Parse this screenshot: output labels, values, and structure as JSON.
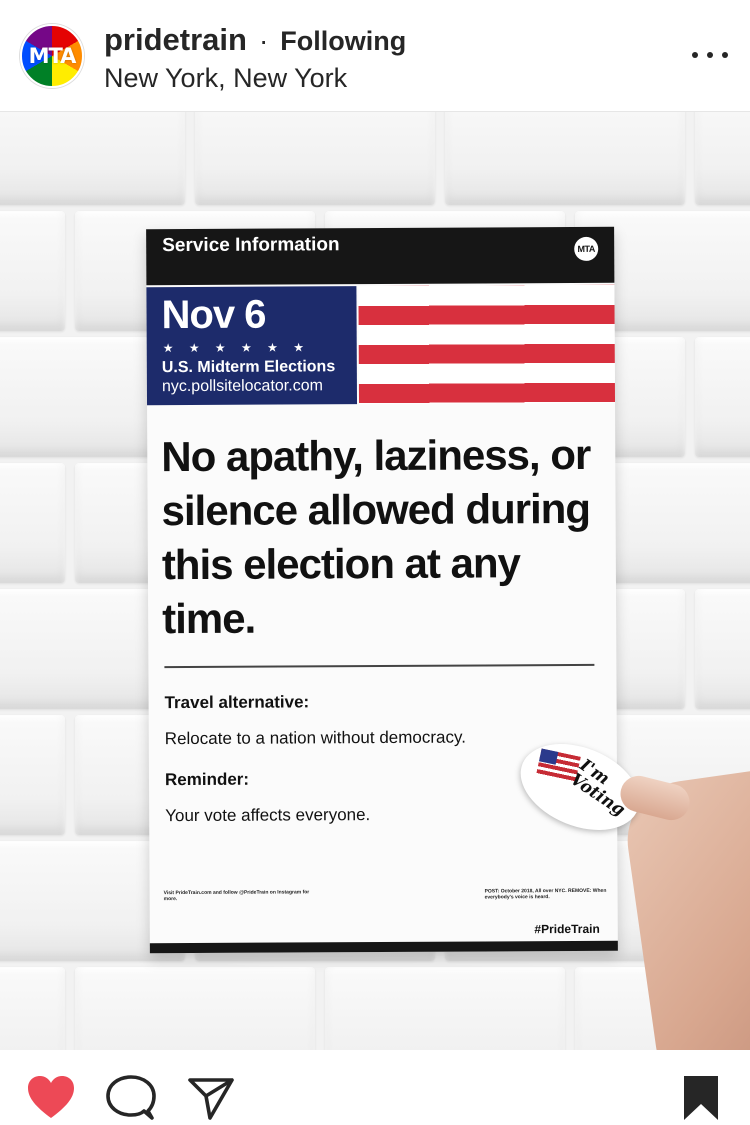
{
  "post": {
    "avatar_text": "MTA",
    "username": "pridetrain",
    "separator": "·",
    "follow_state": "Following",
    "location": "New York, New York"
  },
  "photo": {
    "service_info": "Service Information",
    "logo_text": "MTA",
    "date": "Nov 6",
    "stars": "★ ★ ★ ★ ★ ★",
    "election": "U.S. Midterm Elections",
    "url": "nyc.pollsitelocator.com",
    "headline": "No apathy, laziness, or silence allowed during this election at any time.",
    "label_1": "Travel alternative:",
    "text_1": "Relocate to a nation without democracy.",
    "label_2": "Reminder:",
    "text_2": "Your vote affects everyone.",
    "fine_print_left": "Visit PrideTrain.com and follow @PrideTrain on Instagram for more.",
    "fine_print_right": "POST: October 2018, All over NYC. REMOVE: When everybody's voice is heard.",
    "hashtag": "#PrideTrain",
    "sticker_text": "I'm Voting"
  },
  "colors": {
    "like_red": "#ed4956",
    "flag_blue": "#1d2b6b",
    "flag_red": "#d8303e",
    "text": "#262626"
  },
  "icons": {
    "more": "more-options-icon",
    "like": "heart-icon",
    "comment": "comment-bubble-icon",
    "share": "paper-plane-icon",
    "save": "bookmark-icon"
  },
  "state": {
    "liked": true,
    "saved": true
  }
}
